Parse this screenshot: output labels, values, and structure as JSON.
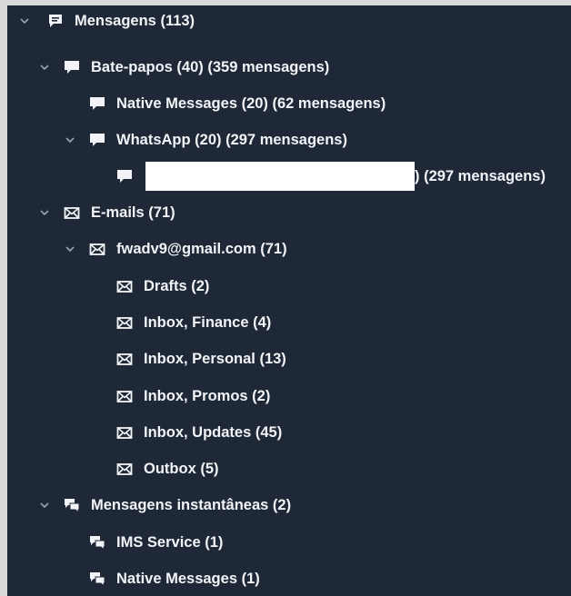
{
  "tree": {
    "root": {
      "label": "Mensagens (113)",
      "icon": "message-icon"
    },
    "chats": {
      "label": "Bate-papos (40)  (359 mensagens)",
      "icon": "chat-bubble-icon"
    },
    "native_messages": {
      "label": "Native Messages (20)  (62 mensagens)",
      "icon": "chat-bubble-icon"
    },
    "whatsapp": {
      "label": "WhatsApp (20)  (297 mensagens)",
      "icon": "chat-bubble-icon"
    },
    "whatsapp_contact": {
      "label_suffix": ")  (297 mensagens)",
      "icon": "chat-bubble-icon"
    },
    "emails": {
      "label": "E-mails (71)",
      "icon": "envelope-icon"
    },
    "account": {
      "label": "fwadv9@gmail.com (71)",
      "icon": "envelope-icon"
    },
    "folders": [
      {
        "label": "Drafts (2)"
      },
      {
        "label": "Inbox, Finance (4)"
      },
      {
        "label": "Inbox, Personal (13)"
      },
      {
        "label": "Inbox, Promos (2)"
      },
      {
        "label": "Inbox, Updates (45)"
      },
      {
        "label": "Outbox (5)"
      }
    ],
    "instant": {
      "label": "Mensagens instantâneas (2)",
      "icon": "im-icon"
    },
    "instant_items": [
      {
        "label": "IMS Service (1)"
      },
      {
        "label": "Native Messages (1)"
      }
    ]
  },
  "colors": {
    "panel_bg": "#1e2836",
    "text": "#f2f4f7",
    "chevron": "#9aa3ae",
    "redaction": "#ffffff"
  }
}
